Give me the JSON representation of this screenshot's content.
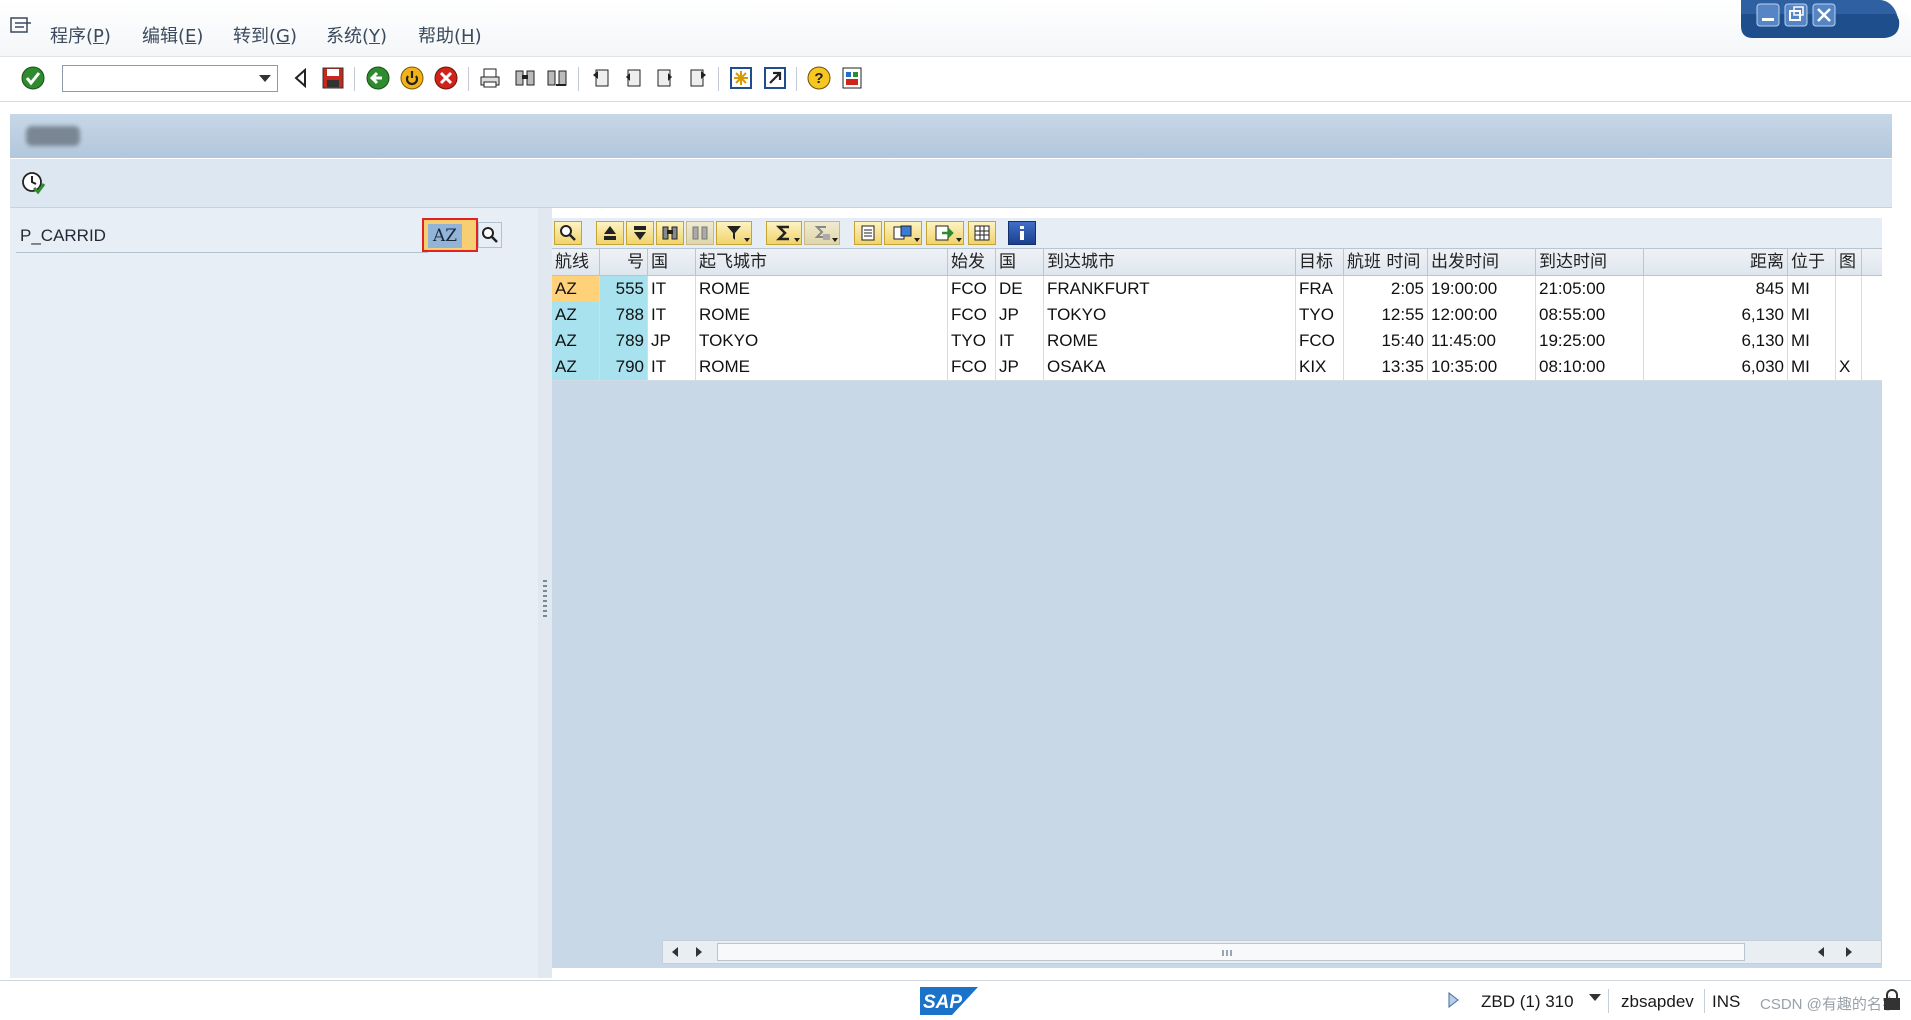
{
  "menubar": {
    "items": [
      {
        "label": "程序(",
        "key": "P",
        "tail": ")"
      },
      {
        "label": "编辑(",
        "key": "E",
        "tail": ")"
      },
      {
        "label": "转到(",
        "key": "G",
        "tail": ")"
      },
      {
        "label": "系统(",
        "key": "Y",
        "tail": ")"
      },
      {
        "label": "帮助(",
        "key": "H",
        "tail": ")"
      }
    ]
  },
  "toolbar": {
    "command_field_value": "",
    "icons": [
      "enter-icon",
      "back-arrow-icon",
      "save-icon",
      "back-icon",
      "exit-icon",
      "cancel-icon",
      "print-icon",
      "find-icon",
      "find-next-icon",
      "first-page-icon",
      "prev-page-icon",
      "next-page-icon",
      "last-page-icon",
      "new-session-icon",
      "create-shortcut-icon",
      "help-icon",
      "layout-icon"
    ]
  },
  "selection": {
    "param_label": "P_CARRID",
    "param_value": "AZ"
  },
  "grid": {
    "columns": [
      "航线",
      "号",
      "国",
      "起飞城市",
      "始发",
      "国",
      "到达城市",
      "目标",
      "航班 时间",
      "出发时间",
      "到达时间",
      "距离",
      "位于",
      "图"
    ],
    "rows": [
      [
        "AZ",
        "555",
        "IT",
        "ROME",
        "FCO",
        "DE",
        "FRANKFURT",
        "FRA",
        "2:05",
        "19:00:00",
        "21:05:00",
        "845",
        "MI",
        ""
      ],
      [
        "AZ",
        "788",
        "IT",
        "ROME",
        "FCO",
        "JP",
        "TOKYO",
        "TYO",
        "12:55",
        "12:00:00",
        "08:55:00",
        "6,130",
        "MI",
        ""
      ],
      [
        "AZ",
        "789",
        "JP",
        "TOKYO",
        "TYO",
        "IT",
        "ROME",
        "FCO",
        "15:40",
        "11:45:00",
        "19:25:00",
        "6,130",
        "MI",
        ""
      ],
      [
        "AZ",
        "790",
        "IT",
        "ROME",
        "FCO",
        "JP",
        "OSAKA",
        "KIX",
        "13:35",
        "10:35:00",
        "08:10:00",
        "6,030",
        "MI",
        "X"
      ]
    ]
  },
  "status": {
    "system": "ZBD (1) 310",
    "server": "zbsapdev",
    "mode": "INS",
    "watermark": "CSDN @有趣的名字"
  },
  "colors": {
    "key_column": "#a8e2ef",
    "selected_cell": "#ffd27a",
    "grid_background": "#c8d8e6",
    "title_bar": "#b8cce0"
  }
}
